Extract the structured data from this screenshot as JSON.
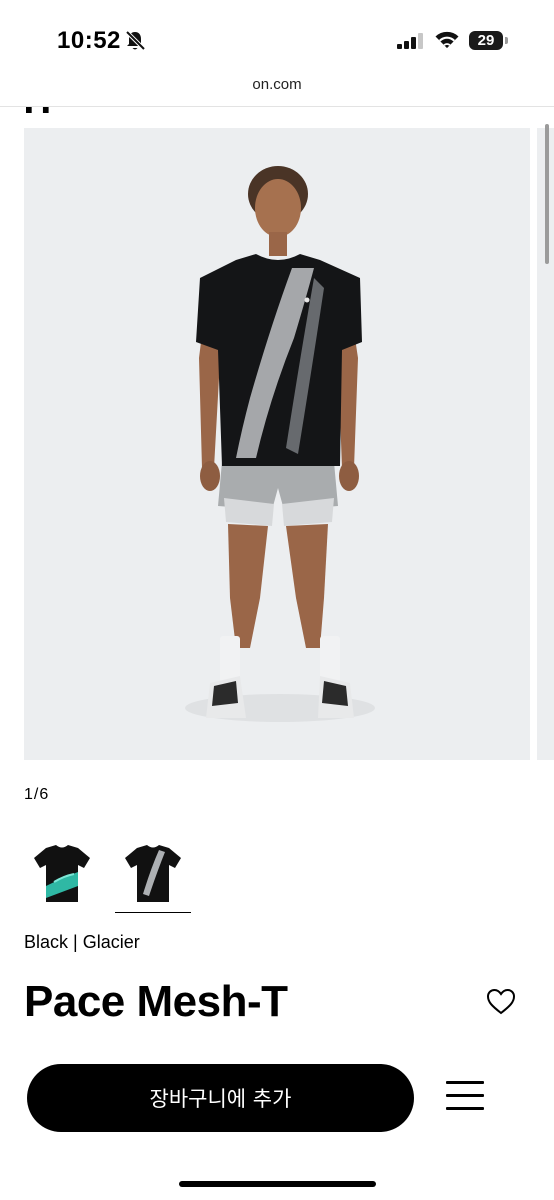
{
  "status": {
    "time": "10:52",
    "battery": "29"
  },
  "browser": {
    "url": "on.com"
  },
  "gallery": {
    "counter": "1/6"
  },
  "product": {
    "color": "Black | Glacier",
    "name": "Pace Mesh-T",
    "add_to_cart": "장바구니에 추가"
  },
  "icons": [
    "bell-slash-icon",
    "signal-icon",
    "wifi-icon",
    "battery-icon",
    "heart-icon",
    "menu-icon"
  ]
}
